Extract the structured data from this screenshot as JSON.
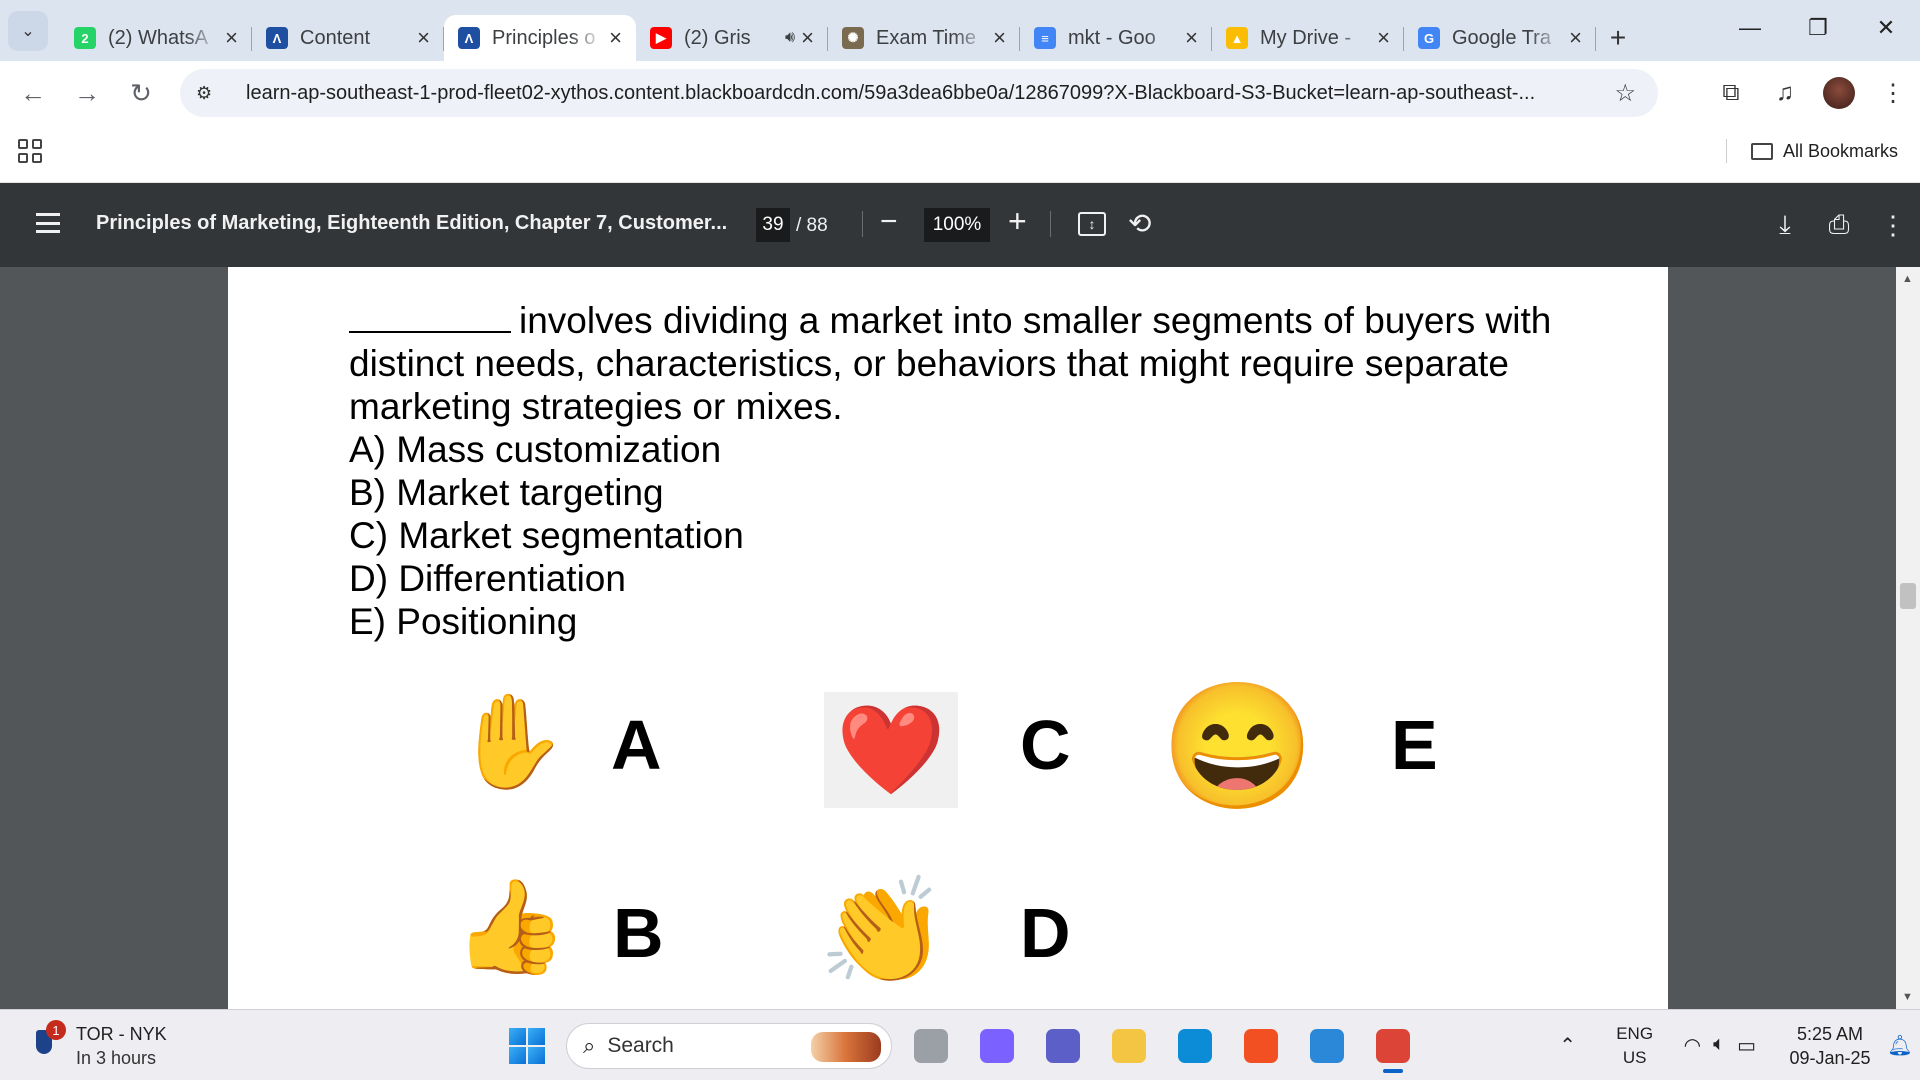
{
  "browser": {
    "tabs": [
      {
        "title": "(2) WhatsA",
        "favicon": "whatsapp-icon",
        "favicon_color": "#25d366",
        "favicon_text": "2"
      },
      {
        "title": "Content",
        "favicon": "blackboard-icon",
        "favicon_color": "#1f4fa0",
        "favicon_text": "Λ"
      },
      {
        "title": "Principles o",
        "favicon": "blackboard-icon",
        "favicon_color": "#1f4fa0",
        "favicon_text": "Λ",
        "active": true
      },
      {
        "title": "(2) Gris",
        "favicon": "youtube-icon",
        "favicon_color": "#ff0000",
        "favicon_text": "▶",
        "audio": true
      },
      {
        "title": "Exam Time",
        "favicon": "pinecone-icon",
        "favicon_color": "#7a6a4f",
        "favicon_text": "✺"
      },
      {
        "title": "mkt - Goo",
        "favicon": "google-docs-icon",
        "favicon_color": "#4285f4",
        "favicon_text": "≡"
      },
      {
        "title": "My Drive -",
        "favicon": "google-drive-icon",
        "favicon_color": "#fbbc04",
        "favicon_text": "▲"
      },
      {
        "title": "Google Tra",
        "favicon": "google-translate-icon",
        "favicon_color": "#4285f4",
        "favicon_text": "G"
      }
    ],
    "url": "learn-ap-southeast-1-prod-fleet02-xythos.content.blackboardcdn.com/59a3dea6bbe0a/12867099?X-Blackboard-S3-Bucket=learn-ap-southeast-...",
    "all_bookmarks": "All Bookmarks"
  },
  "pdf_viewer": {
    "title": "Principles of Marketing, Eighteenth Edition, Chapter 7, Customer...",
    "page_current": "39",
    "page_total": "/ 88",
    "zoom": "100%"
  },
  "document": {
    "question_text": "involves dividing a market into smaller segments of buyers with distinct needs, characteristics, or behaviors that might require separate marketing strategies or mixes.",
    "options": [
      "A) Mass customization",
      "B) Market targeting",
      "C) Market segmentation",
      "D) Differentiation",
      "E) Positioning"
    ],
    "reactions": [
      {
        "letter": "A",
        "emoji": "✋",
        "icon": "raised-hand-emoji"
      },
      {
        "letter": "B",
        "emoji": "👍",
        "icon": "thumbs-up-emoji"
      },
      {
        "letter": "C",
        "emoji": "❤️",
        "icon": "heart-emoji"
      },
      {
        "letter": "D",
        "emoji": "👏",
        "icon": "clapping-hands-emoji"
      },
      {
        "letter": "E",
        "emoji": "😄",
        "icon": "grinning-face-emoji"
      }
    ]
  },
  "taskbar": {
    "weather_badge": "1",
    "weather_title": "TOR - NYK",
    "weather_sub": "In 3 hours",
    "search_placeholder": "Search",
    "lang_top": "ENG",
    "lang_bottom": "US",
    "time": "5:25 AM",
    "date": "09-Jan-25",
    "apps": [
      {
        "name": "taskview-icon",
        "color": "#9aa0a6"
      },
      {
        "name": "copilot-icon",
        "color": "#7b61ff"
      },
      {
        "name": "teams-icon",
        "color": "#5b5fc7"
      },
      {
        "name": "file-explorer-icon",
        "color": "#f4c542"
      },
      {
        "name": "edge-icon",
        "color": "#0c8bd6"
      },
      {
        "name": "microsoft-store-icon",
        "color": "#f25022"
      },
      {
        "name": "help-icon",
        "color": "#2b88d8"
      },
      {
        "name": "chrome-icon",
        "color": "#db4437",
        "active": true
      }
    ]
  }
}
